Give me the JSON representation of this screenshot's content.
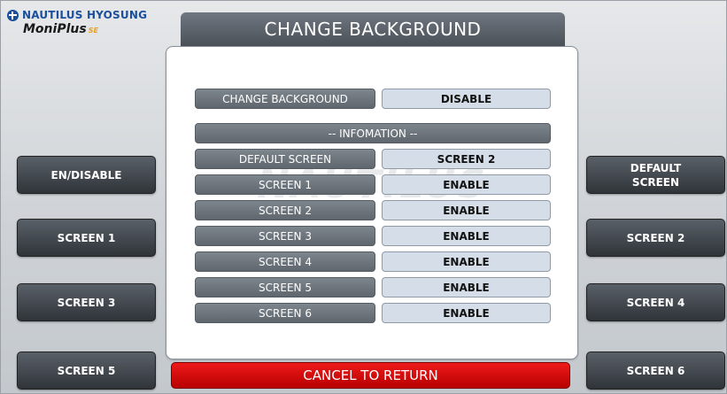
{
  "brand": {
    "company": "NAUTILUS HYOSUNG",
    "product": "MoniPlus",
    "product_suffix": "SE"
  },
  "title": "CHANGE BACKGROUND",
  "setting": {
    "label": "CHANGE BACKGROUND",
    "value": "DISABLE"
  },
  "info_header": "-- INFOMATION --",
  "rows": [
    {
      "label": "DEFAULT SCREEN",
      "value": "SCREEN 2"
    },
    {
      "label": "SCREEN 1",
      "value": "ENABLE"
    },
    {
      "label": "SCREEN 2",
      "value": "ENABLE"
    },
    {
      "label": "SCREEN 3",
      "value": "ENABLE"
    },
    {
      "label": "SCREEN 4",
      "value": "ENABLE"
    },
    {
      "label": "SCREEN 5",
      "value": "ENABLE"
    },
    {
      "label": "SCREEN 6",
      "value": "ENABLE"
    }
  ],
  "left_buttons": [
    "EN/DISABLE",
    "SCREEN 1",
    "SCREEN 3",
    "SCREEN 5"
  ],
  "right_buttons": [
    "DEFAULT\nSCREEN",
    "SCREEN 2",
    "SCREEN 4",
    "SCREEN 6"
  ],
  "cancel_label": "CANCEL TO RETURN",
  "colors": {
    "cancel": "#d40000",
    "title_bar": "#5a6068",
    "value_cell": "#d5dee8"
  }
}
